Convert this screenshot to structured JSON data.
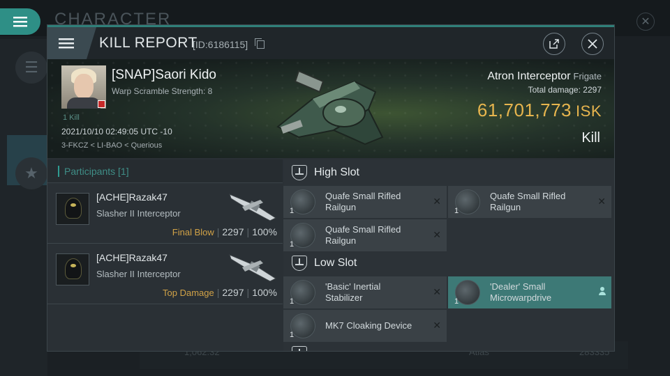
{
  "background": {
    "title": "CHARACTER",
    "footer_left": "1,062.32",
    "footer_mid": "Atlas",
    "footer_right": "283335"
  },
  "header": {
    "title": "KILL REPORT",
    "id": "[ID:6186115]"
  },
  "victim": {
    "name": "[SNAP]Saori Kido",
    "scram": "Warp Scramble Strength: 8",
    "kill_tag": "1 Kill",
    "datetime": "2021/10/10 02:49:05 UTC -10",
    "location": "3-FKCZ < LI-BAO < Querious",
    "ship": "Atron Interceptor",
    "ship_class": "Frigate",
    "total_damage_label": "Total damage:",
    "total_damage": "2297",
    "isk_value": "61,701,773",
    "isk_unit": "ISK",
    "result": "Kill"
  },
  "participants": {
    "header": "Participants [1]",
    "rows": [
      {
        "name": "[ACHE]Razak47",
        "ship": "Slasher II Interceptor",
        "tag": "Final Blow",
        "damage": "2297",
        "percent": "100%"
      },
      {
        "name": "[ACHE]Razak47",
        "ship": "Slasher II Interceptor",
        "tag": "Top Damage",
        "damage": "2297",
        "percent": "100%"
      }
    ]
  },
  "fittings": {
    "high": {
      "label": "High Slot",
      "items": [
        {
          "qty": "1",
          "name_1": "Quafe Small Rifled",
          "name_2": "Railgun"
        },
        {
          "qty": "1",
          "name_1": "Quafe Small Rifled",
          "name_2": "Railgun"
        },
        {
          "qty": "1",
          "name_1": "Quafe Small Rifled",
          "name_2": "Railgun"
        }
      ]
    },
    "low": {
      "label": "Low Slot",
      "items": [
        {
          "qty": "1",
          "name_1": "'Basic' Inertial",
          "name_2": "Stabilizer"
        },
        {
          "qty": "1",
          "name_1": "'Dealer' Small",
          "name_2": "Microwarpdrive"
        },
        {
          "qty": "1",
          "name_1": "MK7 Cloaking Device",
          "name_2": ""
        }
      ]
    }
  },
  "colors": {
    "accent": "#2f9c92",
    "isk": "#e7b54e",
    "tag": "#d1a247",
    "selected_item": "#3d7976"
  }
}
